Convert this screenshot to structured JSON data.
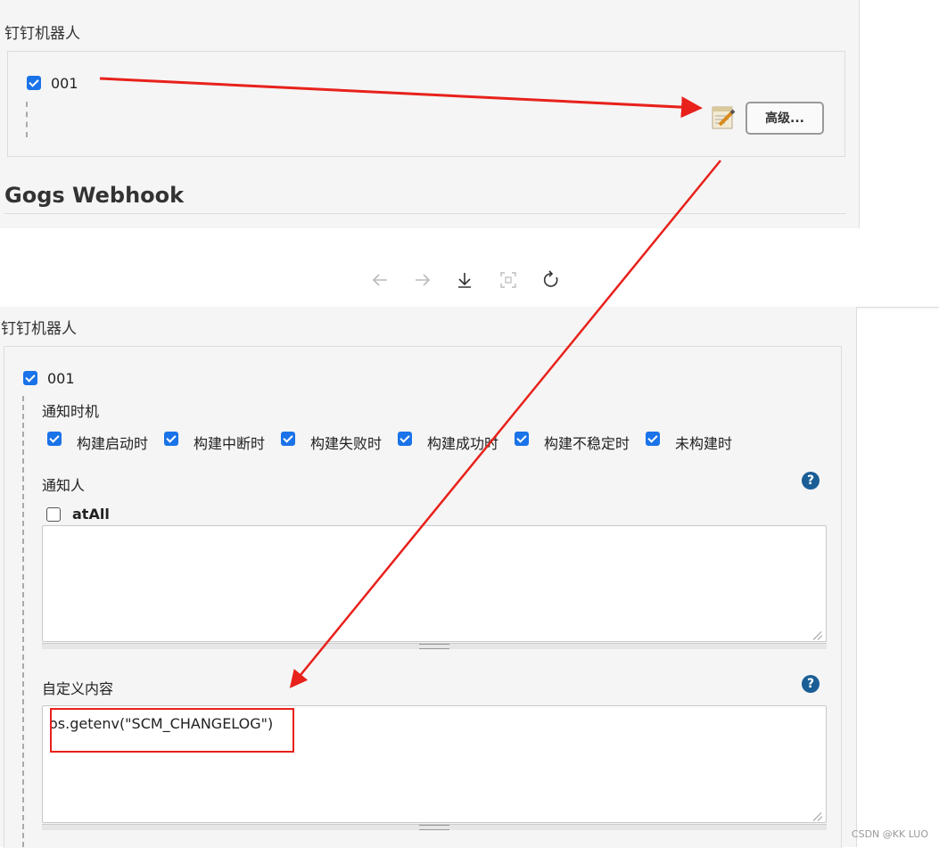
{
  "top": {
    "section_title": "钉钉机器人",
    "robot_name": "001",
    "advanced_button": "高级...",
    "heading": "Gogs Webhook"
  },
  "toolbar": {
    "icons": [
      "back-arrow-icon",
      "forward-arrow-icon",
      "download-icon",
      "fit-screen-icon",
      "rotate-icon"
    ]
  },
  "bottom": {
    "section_title": "钉钉机器人",
    "robot_name": "001",
    "notify_timing_label": "通知时机",
    "timing_options": [
      "构建启动时",
      "构建中断时",
      "构建失败时",
      "构建成功时",
      "构建不稳定时",
      "未构建时"
    ],
    "notify_people_label": "通知人",
    "at_all_label": "atAll",
    "custom_content_label": "自定义内容",
    "custom_content_value": "os.getenv(\"SCM_CHANGELOG\")",
    "help_glyph": "?"
  },
  "watermark": "CSDN @KK LUO",
  "colors": {
    "accent": "#1a73e8",
    "annotation_red": "#e8211b",
    "help_blue": "#1b5e96"
  }
}
